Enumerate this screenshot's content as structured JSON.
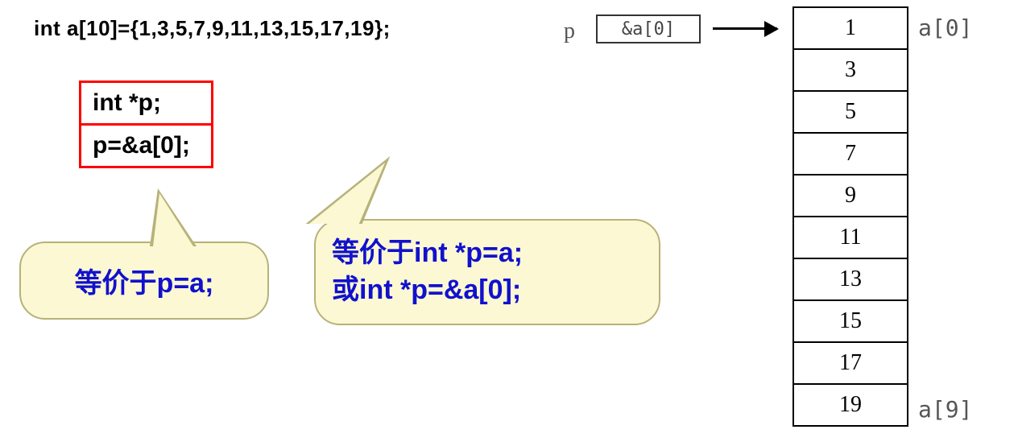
{
  "declaration": "int a[10]={1,3,5,7,9,11,13,15,17,19};",
  "pointer": {
    "label": "p",
    "value": "&a[0]"
  },
  "array": {
    "values": [
      "1",
      "3",
      "5",
      "7",
      "9",
      "11",
      "13",
      "15",
      "17",
      "19"
    ],
    "first_label": "a[0]",
    "last_label": "a[9]"
  },
  "code_box": {
    "line1": "int  *p;",
    "line2": "p=&a[0];"
  },
  "callout1": {
    "text": "等价于p=a;"
  },
  "callout2": {
    "line1": "等价于int *p=a;",
    "line2": "或int *p=&a[0];"
  }
}
